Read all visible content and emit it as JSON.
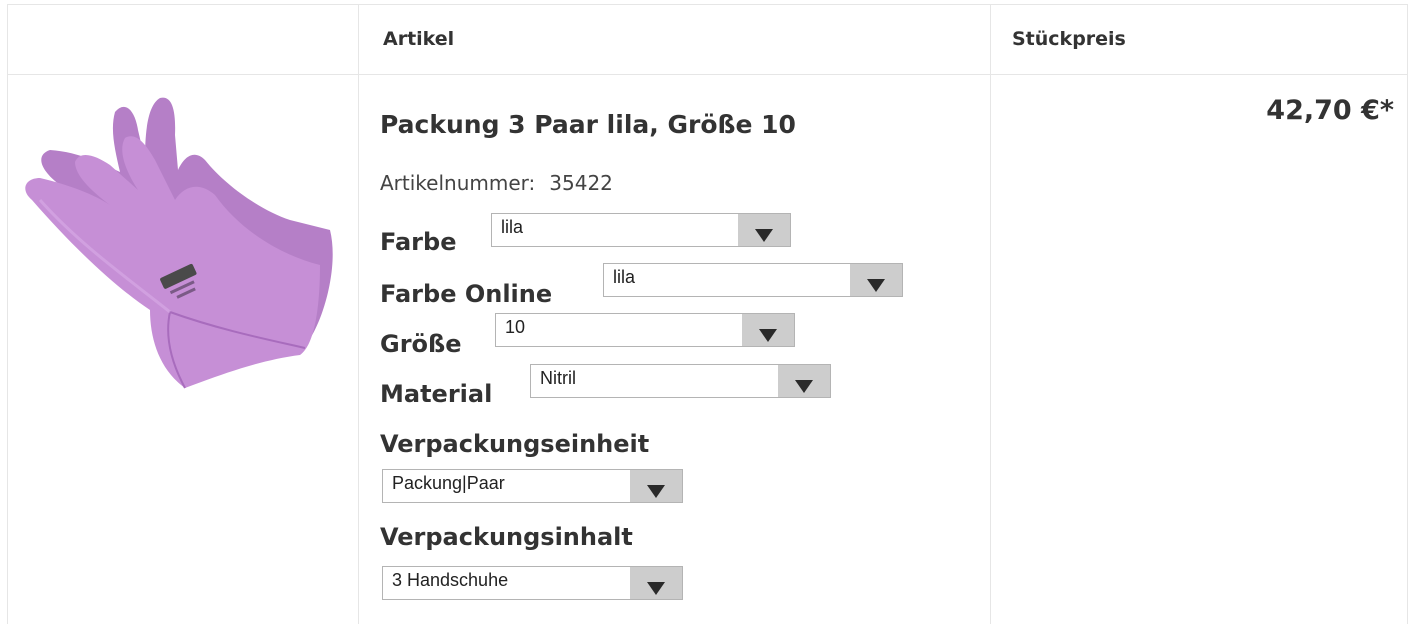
{
  "table": {
    "headers": {
      "article": "Artikel",
      "unit_price": "Stückpreis"
    }
  },
  "product": {
    "title": "Packung 3 Paar lila, Größe 10",
    "article_number_label": "Artikelnummer:",
    "article_number": "35422",
    "price": "42,70 €*"
  },
  "options": [
    {
      "label": "Farbe",
      "value": "lila"
    },
    {
      "label": "Farbe Online",
      "value": "lila"
    },
    {
      "label": "Größe",
      "value": "10"
    },
    {
      "label": "Material",
      "value": "Nitril"
    },
    {
      "label": "Verpackungseinheit",
      "value": "Packung|Paar"
    },
    {
      "label": "Verpackungsinhalt",
      "value": "3 Handschuhe"
    }
  ],
  "colors": {
    "glove": "#c68fd6",
    "select_button": "#cdcdcd",
    "border": "#e6e6e6"
  },
  "icons": {
    "select_arrow": "chevron-down-icon"
  }
}
